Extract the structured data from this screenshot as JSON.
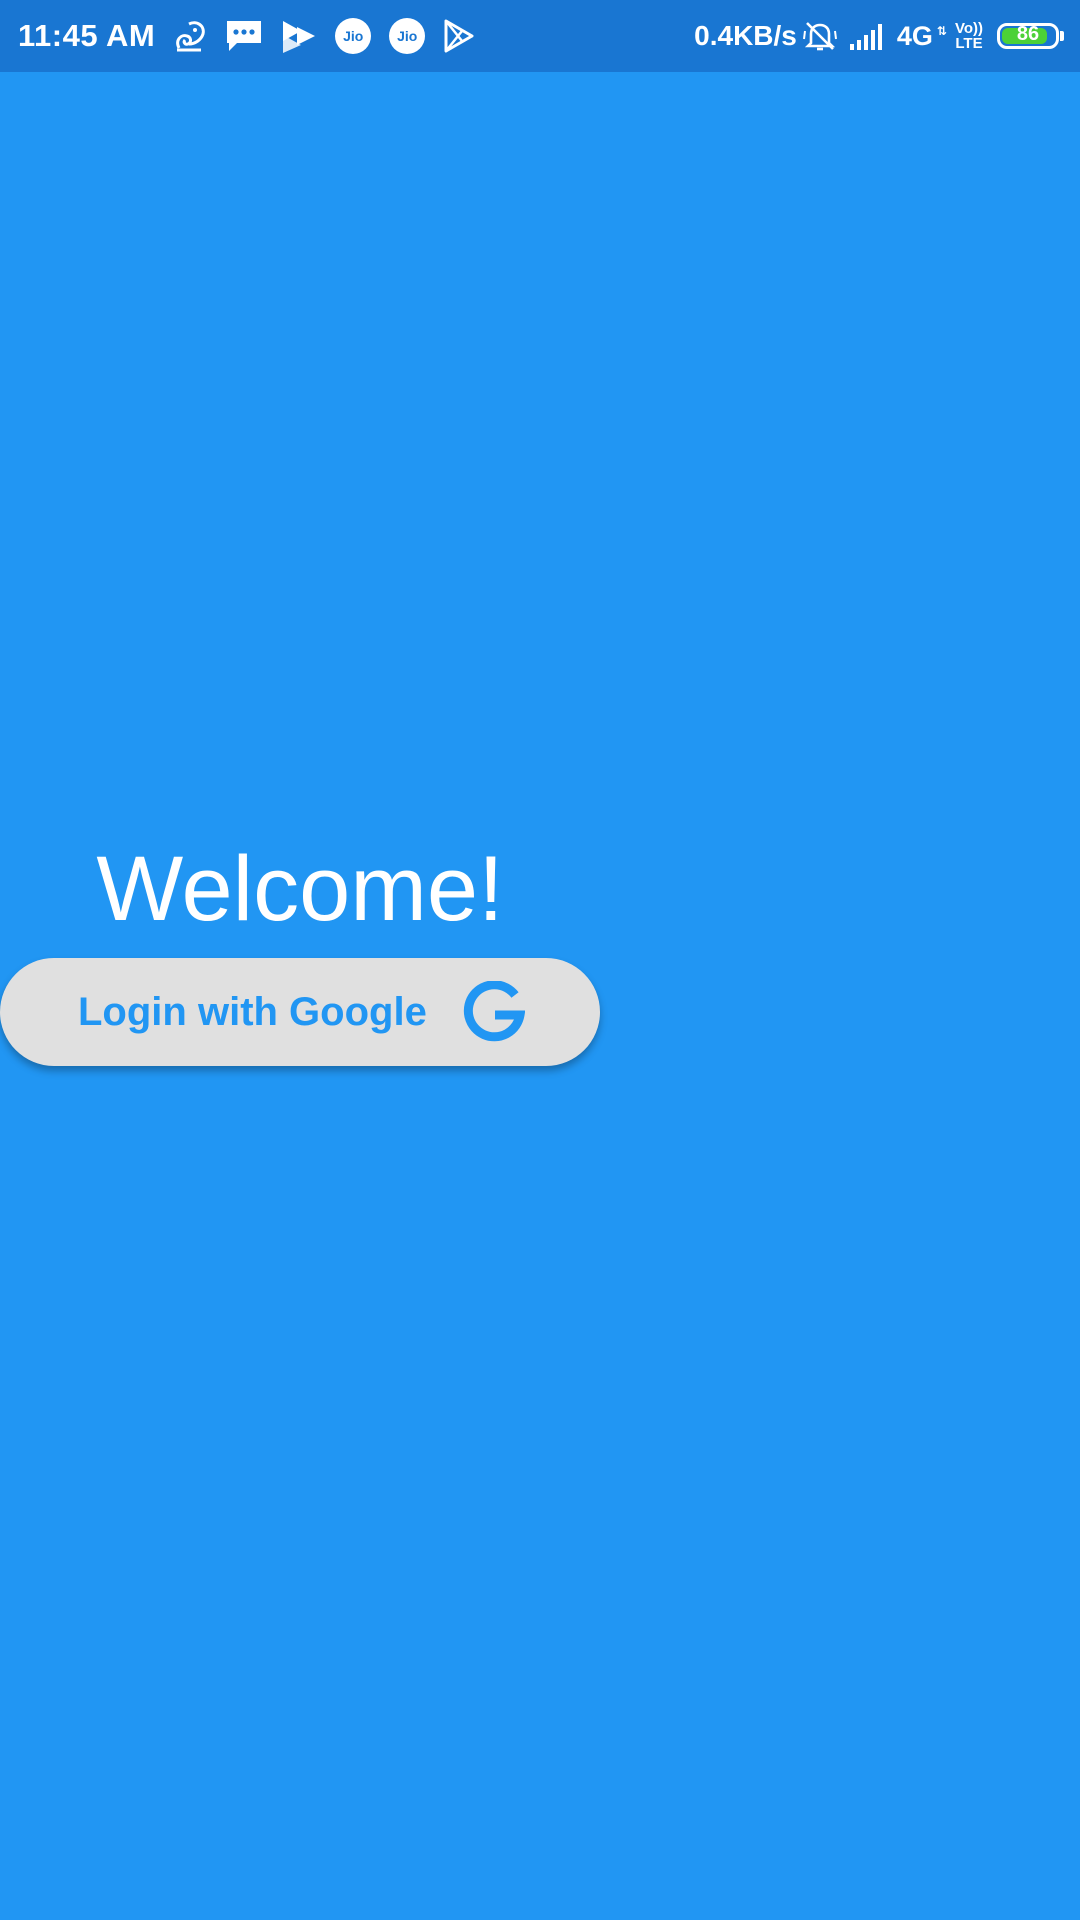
{
  "status_bar": {
    "time": "11:45 AM",
    "jio_1": "Jio",
    "jio_2": "Jio",
    "net_speed": "0.4KB/s",
    "network_type": "4G",
    "network_arrows": "⇅",
    "volte_top": "Vo))",
    "volte_bottom": "LTE",
    "battery_percent": "86",
    "battery_level": 0.86,
    "icons": [
      "uc-browser-icon",
      "messages-icon",
      "play-icon",
      "jio-icon",
      "jio-icon",
      "play-store-icon",
      "bell-off-icon",
      "signal-icon"
    ]
  },
  "main": {
    "welcome_text": "Welcome!",
    "login_button_label": "Login with Google",
    "login_icon": "google-g-icon"
  },
  "colors": {
    "background": "#2196F3",
    "status_bar": "#1976D2",
    "button_bg": "#E0E0E0",
    "accent": "#2196F3",
    "battery_fill": "#4CD137"
  }
}
